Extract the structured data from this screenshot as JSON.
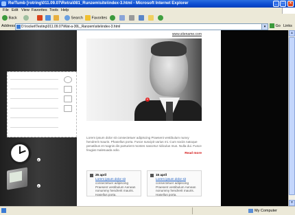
{
  "window": {
    "title": "Re/Tumb [rotring\\011.09.07\\Retra\\081_Runzem\\site\\index-3.html - Microsoft Internet Explorer"
  },
  "menu": [
    "File",
    "Edit",
    "View",
    "Favorites",
    "Tools",
    "Help"
  ],
  "toolbar": {
    "back": "Back",
    "search": "Search",
    "favorites": "Favorites"
  },
  "address": {
    "label": "Address",
    "value": "D:\\rocket\\Testing\\011.09.07\\Wat-a-30L_Ranzem\\site\\index-3.html",
    "go": "Go",
    "links": "Links"
  },
  "page": {
    "site_url": "www.sitename.com",
    "intro": "Lorem ipsum dolor sit consectetuer adipiscing Praesent vestibulum nunvy hendrerit mauris. Phasellus porta. Fusce suscipit varius mi. Cum sociis natoque penatibus et magnis dis parturient montes nascetur ridiculus mus. Nulla dui. Fusce feugiat malesuada odio.",
    "read_more": "Read more",
    "news": [
      {
        "date": "25 april",
        "link": "Lorem ipsum dolor sit",
        "text": "consectetuer adipiscing Praesent vestibulum Aenean nonummy hendrerit mauris. Hasellus porta."
      },
      {
        "date": "15 april",
        "link": "Lorem ipsum dolor sit",
        "text": "consectetuer adipiscing Praesent vestibulum Aenean nonummy hendrerit mauris. Hasellus porta."
      }
    ]
  },
  "status": {
    "zone": "My Computer"
  },
  "colors": {
    "titlebar": "#0b4bd0",
    "read_more": "#d21010",
    "link": "#1a5bbf"
  }
}
